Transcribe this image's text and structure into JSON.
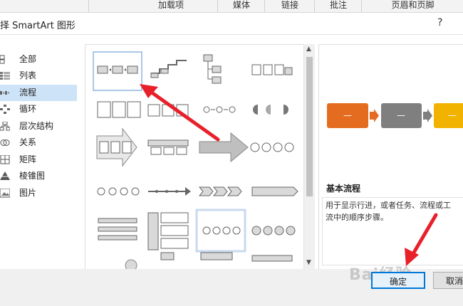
{
  "ribbon": {
    "tabs": [
      "加载项",
      "媒体",
      "链接",
      "批注",
      "页眉和页脚"
    ]
  },
  "dialog": {
    "title": "择 SmartArt 图形",
    "help": "?"
  },
  "categories": [
    {
      "label": "全部",
      "icon": "all-icon"
    },
    {
      "label": "列表",
      "icon": "list-icon"
    },
    {
      "label": "流程",
      "icon": "process-icon",
      "selected": true
    },
    {
      "label": "循环",
      "icon": "cycle-icon"
    },
    {
      "label": "层次结构",
      "icon": "hierarchy-icon"
    },
    {
      "label": "关系",
      "icon": "relationship-icon"
    },
    {
      "label": "矩阵",
      "icon": "matrix-icon"
    },
    {
      "label": "棱锥图",
      "icon": "pyramid-icon"
    },
    {
      "label": "图片",
      "icon": "picture-icon"
    }
  ],
  "preview": {
    "title": "基本流程",
    "description": "用于显示行进，或者任务、流程或工<br>流中的顺序步骤。",
    "desc_line1": "用于显示行进，或者任务、流程或工",
    "desc_line2": "流中的顺序步骤。",
    "box_label": "—",
    "colors": {
      "box1": "#e46c21",
      "box2": "#7f7f7f",
      "box3": "#f2b200",
      "arrow1": "#e46c21",
      "arrow2": "#7f7f7f"
    }
  },
  "buttons": {
    "ok": "确定",
    "cancel": "取消"
  },
  "watermark": "Bai经验",
  "colors": {
    "selection": "#cde3f7",
    "annotation_arrow": "#e8202a",
    "focus_border": "#0078d7"
  }
}
